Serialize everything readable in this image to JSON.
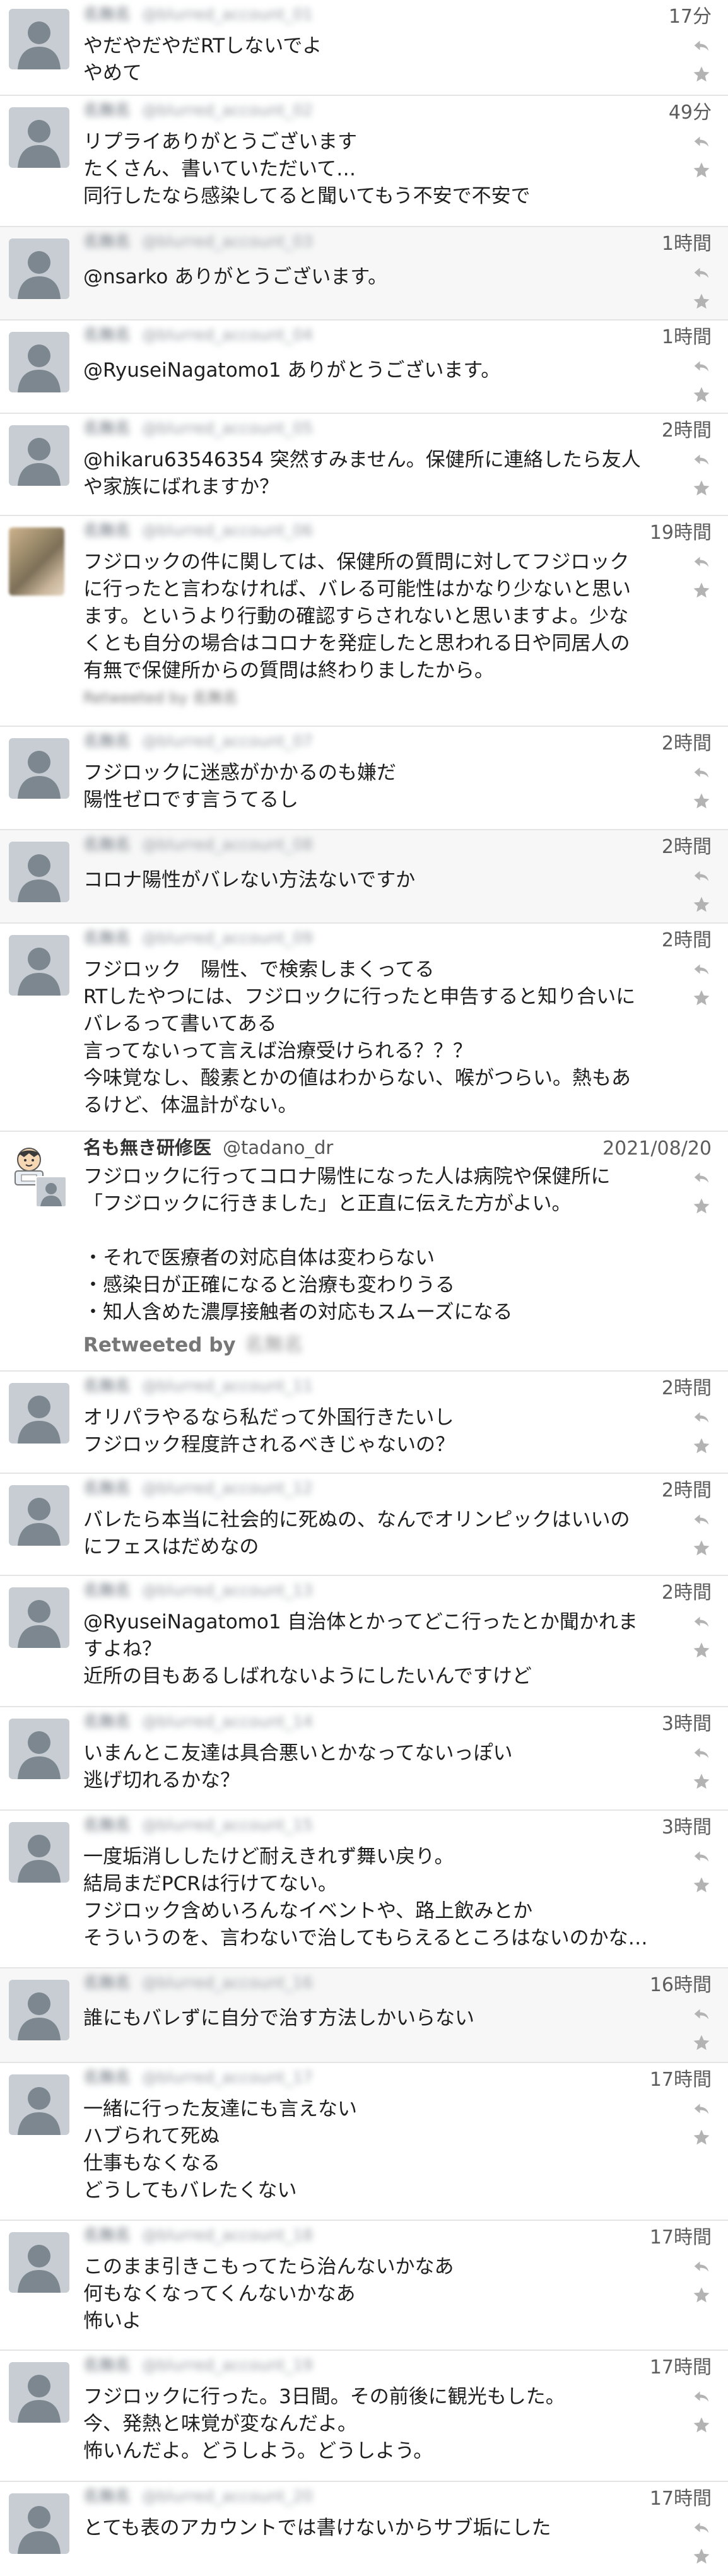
{
  "icons": {
    "reply": "reply-icon",
    "favorite": "star-icon",
    "avatar": "default-avatar-icon"
  },
  "colors": {
    "time": "#5c5c5c",
    "text": "#1f1f1f",
    "muted": "#9aa0a6",
    "action": "#b3b3b3"
  },
  "tweets": [
    {
      "display_name": "名無名",
      "screen_name": "@blurred_account_01",
      "time": "17分",
      "text": "やだやだやだRTしないでよ\nやめて"
    },
    {
      "display_name": "名無名",
      "screen_name": "@blurred_account_02",
      "time": "49分",
      "text": "リプライありがとうございます\nたくさん、書いていただいて…\n同行したなら感染してると聞いてもう不安で不安で"
    },
    {
      "display_name": "名無名",
      "screen_name": "@blurred_account_03",
      "time": "1時間",
      "text": "@nsarko ありがとうございます。"
    },
    {
      "display_name": "名無名",
      "screen_name": "@blurred_account_04",
      "time": "1時間",
      "text": "@RyuseiNagatomo1 ありがとうございます。"
    },
    {
      "display_name": "名無名",
      "screen_name": "@blurred_account_05",
      "time": "2時間",
      "text": "@hikaru63546354 突然すみません。保健所に連絡したら友人\nや家族にばれますか？"
    },
    {
      "display_name": "名無名",
      "screen_name": "@blurred_account_06",
      "time": "19時間",
      "text": "フジロックの件に関しては、保健所の質問に対してフジロック\nに行ったと言わなければ、バレる可能性はかなり少ないと思い\nます。というより行動の確認すらされないと思いますよ。少な\nくとも自分の場合はコロナを発症したと思われる日や同居人の\n有無で保健所からの質問は終わりましたから。",
      "retweeted_by": "Retweeted by 名無名"
    },
    {
      "display_name": "名無名",
      "screen_name": "@blurred_account_07",
      "time": "2時間",
      "text": "フジロックに迷惑がかかるのも嫌だ\n陽性ゼロです言うてるし"
    },
    {
      "display_name": "名無名",
      "screen_name": "@blurred_account_08",
      "time": "2時間",
      "text": "コロナ陽性がバレない方法ないですか"
    },
    {
      "display_name": "名無名",
      "screen_name": "@blurred_account_09",
      "time": "2時間",
      "text": "フジロック　陽性、で検索しまくってる\nRTしたやつには、フジロックに行ったと申告すると知り合いに\nバレるって書いてある\n言ってないって言えば治療受けられる？？？\n今味覚なし、酸素とかの値はわからない、喉がつらい。熱もあ\nるけど、体温計がない。"
    },
    {
      "display_name": "名も無き研修医",
      "screen_name": "@tadano_dr",
      "time": "2021/08/20",
      "text": "フジロックに行ってコロナ陽性になった人は病院や保健所に\n「フジロックに行きました」と正直に伝えた方がよい。\n\n・それで医療者の対応自体は変わらない\n・感染日が正確になると治療も変わりうる\n・知人含めた濃厚接触者の対応もスムーズになる",
      "retweeted_label": "Retweeted by",
      "retweeted_name": "名無名"
    },
    {
      "display_name": "名無名",
      "screen_name": "@blurred_account_11",
      "time": "2時間",
      "text": "オリパラやるなら私だって外国行きたいし\nフジロック程度許されるべきじゃないの？"
    },
    {
      "display_name": "名無名",
      "screen_name": "@blurred_account_12",
      "time": "2時間",
      "text": "バレたら本当に社会的に死ぬの、なんでオリンピックはいいの\nにフェスはだめなの"
    },
    {
      "display_name": "名無名",
      "screen_name": "@blurred_account_13",
      "time": "2時間",
      "text": "@RyuseiNagatomo1 自治体とかってどこ行ったとか聞かれま\nすよね？\n近所の目もあるしばれないようにしたいんですけど"
    },
    {
      "display_name": "名無名",
      "screen_name": "@blurred_account_14",
      "time": "3時間",
      "text": "いまんとこ友達は具合悪いとかなってないっぽい\n逃げ切れるかな？"
    },
    {
      "display_name": "名無名",
      "screen_name": "@blurred_account_15",
      "time": "3時間",
      "text": "一度垢消ししたけど耐えきれず舞い戻り。\n結局まだPCRは行けてない。\nフジロック含めいろんなイベントや、路上飲みとか\nそういうのを、言わないで治してもらえるところはないのかな…"
    },
    {
      "display_name": "名無名",
      "screen_name": "@blurred_account_16",
      "time": "16時間",
      "text": "誰にもバレずに自分で治す方法しかいらない"
    },
    {
      "display_name": "名無名",
      "screen_name": "@blurred_account_17",
      "time": "17時間",
      "text": "一緒に行った友達にも言えない\nハブられて死ぬ\n仕事もなくなる\nどうしてもバレたくない"
    },
    {
      "display_name": "名無名",
      "screen_name": "@blurred_account_18",
      "time": "17時間",
      "text": "このまま引きこもってたら治んないかなあ\n何もなくなってくんないかなあ\n怖いよ"
    },
    {
      "display_name": "名無名",
      "screen_name": "@blurred_account_19",
      "time": "17時間",
      "text": "フジロックに行った。3日間。その前後に観光もした。\n今、発熱と味覚が変なんだよ。\n怖いんだよ。どうしよう。どうしよう。"
    },
    {
      "display_name": "名無名",
      "screen_name": "@blurred_account_20",
      "time": "17時間",
      "text": "とても表のアカウントでは書けないからサブ垢にした"
    }
  ]
}
